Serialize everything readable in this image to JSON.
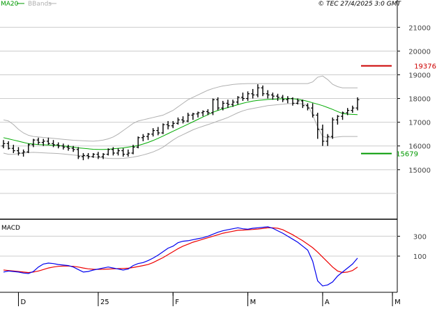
{
  "header": {
    "indicator_labels": [
      "MA20",
      "BBands"
    ],
    "source_timestamp": "© TEC 27/4/2025 3:0 GMT"
  },
  "colors": {
    "bars": "#000000",
    "ma20": "#00aa00",
    "bbands": "#b0b0b0",
    "resistance": "#cc0000",
    "support": "#009900",
    "macd_line": "#0000ee",
    "signal_line": "#ee0000",
    "grid": "#cccccc",
    "axis": "#000000"
  },
  "chart_data": [
    {
      "type": "ohlc",
      "panel": "price",
      "y_ticks": [
        "21000",
        "20000",
        "19000",
        "18000",
        "17000",
        "16000",
        "15000"
      ],
      "ylim": [
        13000,
        21800
      ],
      "x_ticks": [
        "D",
        "25",
        "F",
        "M",
        "A",
        "M"
      ],
      "levels": [
        {
          "label": "19376",
          "value": 19376,
          "style": "resistance"
        },
        {
          "label": "15679",
          "value": 15679,
          "style": "support"
        }
      ],
      "series": [
        {
          "name": "MA20",
          "values": [
            16350,
            16300,
            16250,
            16200,
            16150,
            16100,
            16080,
            16060,
            16050,
            16040,
            16030,
            16020,
            16000,
            15980,
            15950,
            15920,
            15900,
            15880,
            15860,
            15850,
            15850,
            15860,
            15880,
            15900,
            15920,
            15950,
            15980,
            16020,
            16080,
            16150,
            16230,
            16320,
            16420,
            16520,
            16620,
            16720,
            16820,
            16920,
            17020,
            17120,
            17220,
            17320,
            17420,
            17500,
            17560,
            17620,
            17680,
            17740,
            17800,
            17850,
            17890,
            17920,
            17940,
            17960,
            17970,
            17980,
            17990,
            17995,
            17990,
            17970,
            17930,
            17880,
            17820,
            17760,
            17700,
            17620,
            17540,
            17450,
            17370,
            17340,
            17330,
            17320
          ]
        },
        {
          "name": "BBands upper",
          "values": [
            17100,
            17050,
            16900,
            16700,
            16550,
            16450,
            16400,
            16380,
            16360,
            16340,
            16320,
            16300,
            16280,
            16260,
            16240,
            16230,
            16220,
            16210,
            16200,
            16220,
            16250,
            16300,
            16380,
            16500,
            16650,
            16800,
            16950,
            17050,
            17100,
            17150,
            17200,
            17250,
            17300,
            17400,
            17500,
            17650,
            17800,
            17950,
            18050,
            18150,
            18250,
            18350,
            18420,
            18480,
            18530,
            18560,
            18590,
            18610,
            18620,
            18630,
            18630,
            18630,
            18630,
            18630,
            18630,
            18630,
            18630,
            18630,
            18630,
            18630,
            18630,
            18630,
            18700,
            18900,
            18950,
            18800,
            18600,
            18500,
            18450,
            18450,
            18450,
            18450
          ]
        },
        {
          "name": "BBands lower",
          "values": [
            15700,
            15650,
            15650,
            15680,
            15700,
            15720,
            15730,
            15720,
            15710,
            15700,
            15690,
            15680,
            15660,
            15640,
            15620,
            15600,
            15580,
            15560,
            15540,
            15520,
            15500,
            15480,
            15470,
            15470,
            15480,
            15500,
            15530,
            15570,
            15620,
            15680,
            15750,
            15840,
            15950,
            16100,
            16250,
            16380,
            16480,
            16580,
            16680,
            16760,
            16830,
            16900,
            16970,
            17050,
            17120,
            17200,
            17300,
            17400,
            17480,
            17540,
            17580,
            17620,
            17660,
            17700,
            17720,
            17740,
            17760,
            17780,
            17790,
            17790,
            17770,
            17730,
            17300,
            16800,
            16400,
            16350,
            16350,
            16380,
            16400,
            16400,
            16400,
            16400
          ]
        },
        {
          "name": "OHLC",
          "values": [
            [
              16000,
              16250,
              15900,
              16100
            ],
            [
              16100,
              16200,
              15850,
              15900
            ],
            [
              15900,
              16050,
              15700,
              15800
            ],
            [
              15800,
              15950,
              15600,
              15700
            ],
            [
              15700,
              15850,
              15550,
              15750
            ],
            [
              15750,
              16100,
              15700,
              16050
            ],
            [
              16050,
              16300,
              15950,
              16250
            ],
            [
              16250,
              16350,
              16050,
              16150
            ],
            [
              16150,
              16300,
              16000,
              16200
            ],
            [
              16200,
              16350,
              16050,
              16100
            ],
            [
              16100,
              16250,
              15950,
              16050
            ],
            [
              16050,
              16150,
              15900,
              16000
            ],
            [
              16000,
              16100,
              15850,
              15950
            ],
            [
              15950,
              16050,
              15800,
              15900
            ],
            [
              15900,
              16000,
              15750,
              15850
            ],
            [
              15850,
              15950,
              15450,
              15550
            ],
            [
              15550,
              15700,
              15400,
              15600
            ],
            [
              15600,
              15700,
              15450,
              15550
            ],
            [
              15550,
              15700,
              15500,
              15650
            ],
            [
              15650,
              15750,
              15450,
              15550
            ],
            [
              15550,
              15700,
              15450,
              15650
            ],
            [
              15650,
              15900,
              15600,
              15850
            ],
            [
              15850,
              15950,
              15600,
              15700
            ],
            [
              15700,
              15900,
              15600,
              15800
            ],
            [
              15800,
              15900,
              15550,
              15650
            ],
            [
              15650,
              15850,
              15550,
              15700
            ],
            [
              15700,
              16050,
              15650,
              15950
            ],
            [
              15950,
              16400,
              15900,
              16350
            ],
            [
              16350,
              16500,
              16200,
              16400
            ],
            [
              16400,
              16550,
              16250,
              16500
            ],
            [
              16500,
              16750,
              16400,
              16650
            ],
            [
              16650,
              16800,
              16450,
              16550
            ],
            [
              16550,
              16950,
              16500,
              16900
            ],
            [
              16900,
              17050,
              16700,
              16850
            ],
            [
              16850,
              17050,
              16750,
              16950
            ],
            [
              16950,
              17200,
              16900,
              17100
            ],
            [
              17100,
              17250,
              16950,
              17050
            ],
            [
              17050,
              17400,
              17000,
              17300
            ],
            [
              17300,
              17400,
              17100,
              17350
            ],
            [
              17350,
              17450,
              17200,
              17400
            ],
            [
              17400,
              17500,
              17250,
              17450
            ],
            [
              17450,
              17550,
              17300,
              17400
            ],
            [
              17400,
              18000,
              17300,
              17950
            ],
            [
              17950,
              18050,
              17500,
              17600
            ],
            [
              17600,
              17900,
              17500,
              17800
            ],
            [
              17800,
              17950,
              17600,
              17750
            ],
            [
              17750,
              17950,
              17650,
              17850
            ],
            [
              17850,
              18100,
              17750,
              18050
            ],
            [
              18050,
              18250,
              17900,
              18000
            ],
            [
              18000,
              18300,
              17900,
              18200
            ],
            [
              18200,
              18400,
              18000,
              18150
            ],
            [
              18150,
              18600,
              18050,
              18450
            ],
            [
              18450,
              18550,
              18100,
              18200
            ],
            [
              18200,
              18350,
              18000,
              18150
            ],
            [
              18150,
              18250,
              17950,
              18100
            ],
            [
              18100,
              18200,
              17900,
              18050
            ],
            [
              18050,
              18150,
              17850,
              17950
            ],
            [
              17950,
              18100,
              17800,
              18000
            ],
            [
              18000,
              18050,
              17700,
              17800
            ],
            [
              17800,
              18000,
              17750,
              17900
            ],
            [
              17900,
              17950,
              17600,
              17700
            ],
            [
              17700,
              17800,
              17500,
              17600
            ],
            [
              17600,
              17800,
              17200,
              17300
            ],
            [
              17300,
              17400,
              16300,
              16700
            ],
            [
              16700,
              16900,
              16000,
              16200
            ],
            [
              16200,
              16500,
              16000,
              16400
            ],
            [
              16400,
              17200,
              16300,
              17100
            ],
            [
              17100,
              17300,
              16900,
              17250
            ],
            [
              17250,
              17450,
              17100,
              17400
            ],
            [
              17400,
              17600,
              17300,
              17500
            ],
            [
              17500,
              17700,
              17400,
              17600
            ],
            [
              17600,
              18050,
              17500,
              17950
            ]
          ]
        }
      ]
    },
    {
      "type": "line",
      "panel": "macd",
      "title": "MACD",
      "y_ticks": [
        "300",
        "100"
      ],
      "ylim": [
        -250,
        450
      ],
      "series": [
        {
          "name": "MACD",
          "values": [
            -60,
            -50,
            -55,
            -60,
            -70,
            -75,
            -55,
            -10,
            20,
            30,
            25,
            15,
            10,
            5,
            -10,
            -35,
            -60,
            -55,
            -40,
            -30,
            -20,
            -10,
            -20,
            -30,
            -40,
            -30,
            5,
            25,
            35,
            55,
            80,
            110,
            145,
            180,
            200,
            235,
            250,
            255,
            265,
            275,
            285,
            300,
            320,
            340,
            355,
            365,
            375,
            385,
            375,
            370,
            380,
            385,
            390,
            395,
            380,
            355,
            330,
            300,
            270,
            240,
            200,
            160,
            50,
            -150,
            -200,
            -190,
            -160,
            -100,
            -60,
            -20,
            20,
            80
          ]
        },
        {
          "name": "Signal",
          "values": [
            -40,
            -45,
            -50,
            -55,
            -60,
            -65,
            -60,
            -50,
            -35,
            -20,
            -10,
            -3,
            0,
            0,
            -3,
            -10,
            -20,
            -28,
            -32,
            -33,
            -32,
            -30,
            -28,
            -26,
            -24,
            -22,
            -15,
            -5,
            5,
            15,
            35,
            60,
            85,
            115,
            145,
            175,
            200,
            220,
            240,
            255,
            270,
            285,
            300,
            315,
            330,
            340,
            350,
            360,
            362,
            365,
            368,
            372,
            378,
            385,
            385,
            380,
            365,
            340,
            315,
            285,
            255,
            220,
            185,
            140,
            90,
            40,
            -10,
            -50,
            -65,
            -60,
            -45,
            -10
          ]
        }
      ]
    }
  ]
}
